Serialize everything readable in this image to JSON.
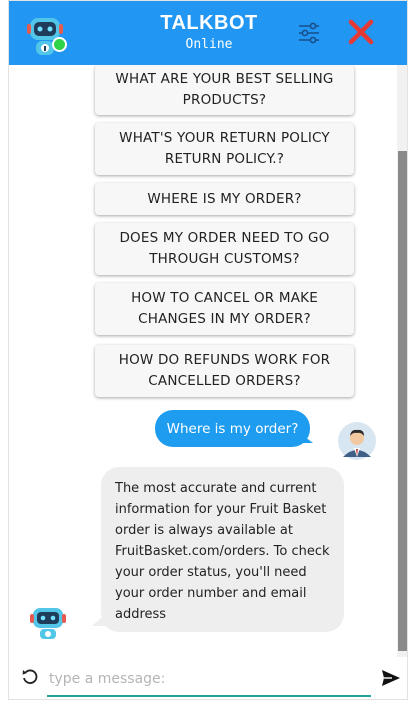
{
  "header": {
    "title": "TALKBOT",
    "status": "Online",
    "icons": {
      "avatar": "robot-avatar-icon",
      "settings": "sliders-icon",
      "close": "close-icon"
    },
    "colors": {
      "header_bg": "#2196f3",
      "online": "#2fd34a",
      "close": "#e53935"
    }
  },
  "quick_replies": [
    {
      "label": "WHAT ARE YOUR BEST SELLING PRODUCTS?"
    },
    {
      "label": "WHAT'S YOUR RETURN POLICY RETURN POLICY.?"
    },
    {
      "label": "WHERE IS MY ORDER?"
    },
    {
      "label": "DOES MY ORDER NEED TO GO THROUGH CUSTOMS?"
    },
    {
      "label": "HOW TO CANCEL OR MAKE CHANGES IN MY ORDER?"
    },
    {
      "label": "HOW DO REFUNDS WORK FOR CANCELLED ORDERS?"
    }
  ],
  "messages": {
    "user": {
      "text": "Where is my order?",
      "color": "#1e9cf0"
    },
    "bot": {
      "text": "The most accurate and current information for your Fruit Basket order is always available at FruitBasket.com/orders. To check your order status, you'll need your order number and email address"
    }
  },
  "composer": {
    "placeholder": "type a message:",
    "icons": {
      "refresh": "refresh-icon",
      "send": "send-icon"
    },
    "accent": "#20a39a"
  }
}
